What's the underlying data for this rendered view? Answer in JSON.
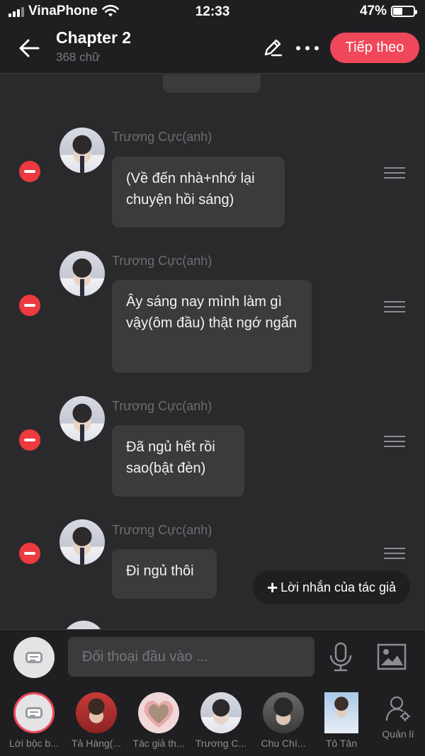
{
  "status_bar": {
    "carrier": "VinaPhone",
    "time": "12:33",
    "battery": "47%",
    "battery_level": 0.47
  },
  "header": {
    "title": "Chapter 2",
    "subtitle": "368 chữ",
    "next_label": "Tiếp theo"
  },
  "messages": [
    {
      "sender": "Trương Cực(anh)",
      "text": "(Về đến nhà+nhớ lại chuyện hồi sáng)"
    },
    {
      "sender": "Trương Cực(anh)",
      "text": "Ây sáng nay mình làm gì vậy(ôm đầu) thật ngớ ngẩn"
    },
    {
      "sender": "Trương Cực(anh)",
      "text": "Đã ngủ hết rồi sao(bật đèn)"
    },
    {
      "sender": "Trương Cực(anh)",
      "text": "Đi ngủ thôi"
    }
  ],
  "author_note_label": "Lời nhắn của tác giả",
  "input": {
    "placeholder": "Đối thoại đầu vào ..."
  },
  "characters": [
    {
      "name": "Lời bộc b..."
    },
    {
      "name": "Tả Hàng(..."
    },
    {
      "name": "Tác giả th..."
    },
    {
      "name": "Trương C..."
    },
    {
      "name": "Chu Chí..."
    },
    {
      "name": "Tô Tân"
    }
  ],
  "manage_label": "Quản lí",
  "colors": {
    "accent": "#f0485a",
    "remove": "#ec3a40",
    "background": "#2a2a2c",
    "bubble": "#3b3b3d"
  }
}
